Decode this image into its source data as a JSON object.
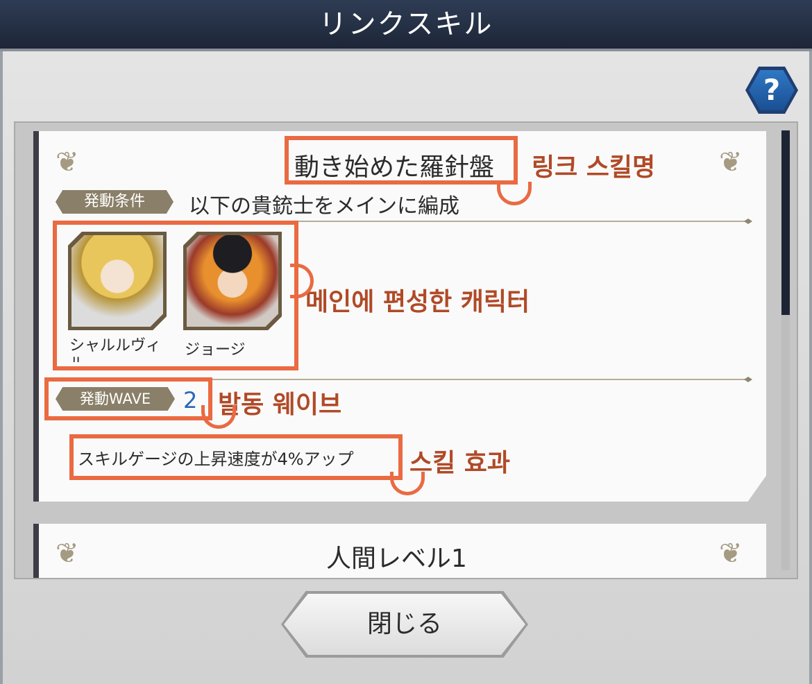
{
  "header": {
    "title": "リンクスキル"
  },
  "help_button": {
    "label": "?"
  },
  "skill_card": {
    "skill_name": "動き始めた羅針盤",
    "condition_badge": "発動条件",
    "condition_text": "以下の貴銃士をメインに編成",
    "characters": [
      {
        "name": "シャルルヴィル"
      },
      {
        "name": "ジョージ"
      }
    ],
    "wave_badge": "発動WAVE",
    "wave_value": "2",
    "effect_text": "スキルゲージの上昇速度が4%アップ"
  },
  "next_card": {
    "title": "人間レベル1"
  },
  "close_button": {
    "label": "閉じる"
  },
  "annotations": {
    "skill_name": "링크 스킬명",
    "main_characters": "메인에 편성한 캐릭터",
    "wave": "발동 웨이브",
    "effect": "스킬 효과"
  },
  "colors": {
    "header_bg": "#1d2638",
    "highlight": "#ea6a42",
    "annotation_text": "#b04a27",
    "wave_value": "#2a67b8",
    "badge_bg": "#8a7f68"
  }
}
